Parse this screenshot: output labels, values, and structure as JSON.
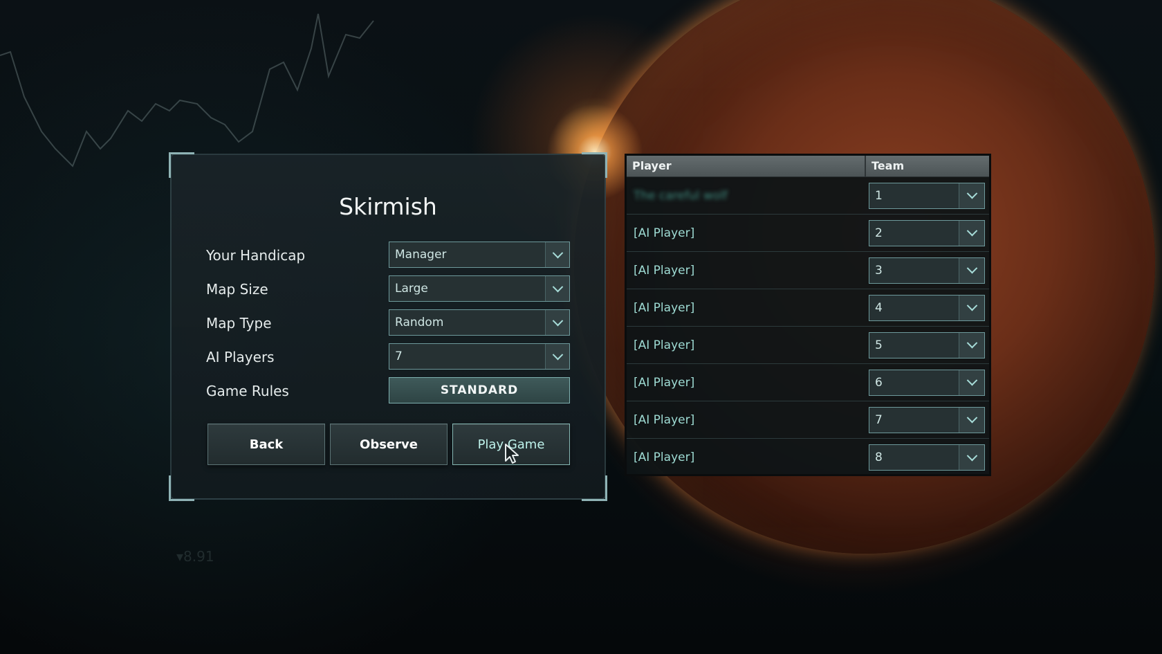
{
  "panel": {
    "title": "Skirmish",
    "rows": [
      {
        "label": "Your Handicap",
        "value": "Manager"
      },
      {
        "label": "Map Size",
        "value": "Large"
      },
      {
        "label": "Map Type",
        "value": "Random"
      },
      {
        "label": "AI Players",
        "value": "7"
      }
    ],
    "game_rules_label": "Game Rules",
    "game_rules_value": "STANDARD",
    "buttons": {
      "back": "Back",
      "observe": "Observe",
      "play": "Play Game"
    }
  },
  "table": {
    "headers": {
      "player": "Player",
      "team": "Team"
    },
    "rows": [
      {
        "player": "The careful wolf",
        "team": "1"
      },
      {
        "player": "[AI Player]",
        "team": "2"
      },
      {
        "player": "[AI Player]",
        "team": "3"
      },
      {
        "player": "[AI Player]",
        "team": "4"
      },
      {
        "player": "[AI Player]",
        "team": "5"
      },
      {
        "player": "[AI Player]",
        "team": "6"
      },
      {
        "player": "[AI Player]",
        "team": "7"
      },
      {
        "player": "[AI Player]",
        "team": "8"
      }
    ]
  },
  "background": {
    "readout": "▾8.91"
  },
  "colors": {
    "accent": "#9fdcd4",
    "panel_bg": "#1a2428",
    "border": "#6e9a9c"
  }
}
